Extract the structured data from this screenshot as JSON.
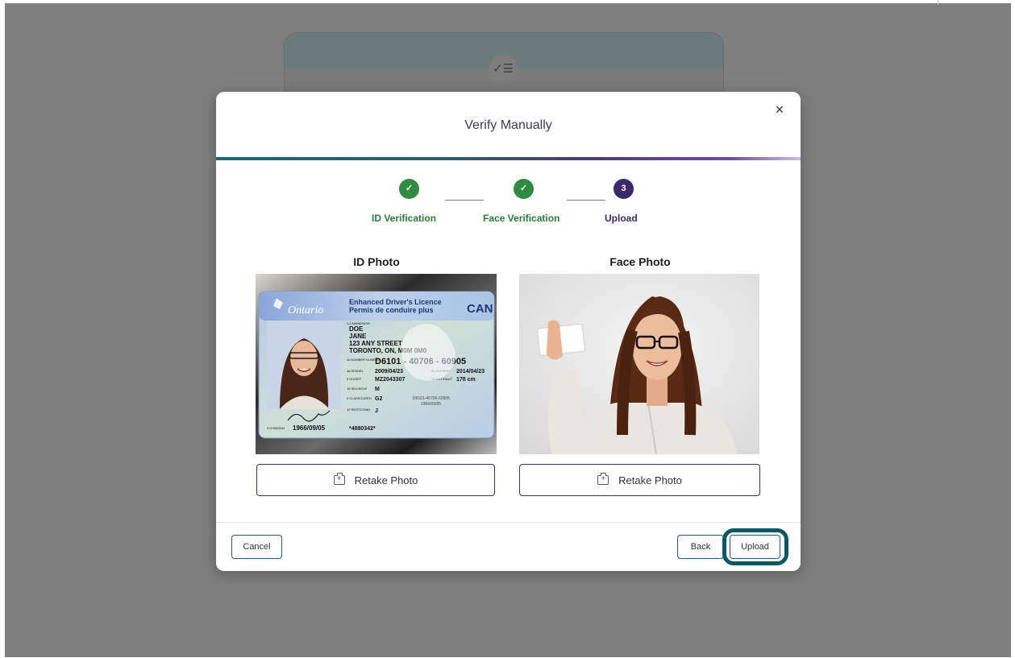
{
  "modal": {
    "title": "Verify Manually",
    "close_icon": "×",
    "check_icon": "✓"
  },
  "stepper": {
    "steps": [
      {
        "label": "ID Verification",
        "status": "done"
      },
      {
        "label": "Face Verification",
        "status": "done"
      },
      {
        "label": "Upload",
        "status": "current",
        "number": "3"
      }
    ],
    "colors": {
      "done": "#2e8b3f",
      "current": "#3b2a6b"
    }
  },
  "photos": {
    "id_heading": "ID Photo",
    "face_heading": "Face Photo",
    "retake_label": "Retake Photo"
  },
  "id_card": {
    "province": "Ontario",
    "title_en": "Enhanced Driver's Licence",
    "title_fr": "Permis de conduire plus",
    "country": "CAN",
    "name_label": "1,2 NAME/NOM",
    "last_name": "DOE",
    "first_name": "JANE",
    "address_line1": "123 ANY STREET",
    "address_line2": "TORONTO, ON, M0M 0M0",
    "number_label": "4d NUMBER NUMÉRO",
    "licence_number": "D6101 - 40706 - 60905",
    "iss_label": "4a ISS/DÉL",
    "issue_date": "2009/04/23",
    "exp_label": "4b EXP/EXP",
    "expiry_date": "2014/04/23",
    "ref_label": "5 DD/REF",
    "ref": "MZ2043307",
    "hgt_label": "16 HGT/HAUT",
    "height": "178 cm",
    "sex_label": "15 SEX/SEXE",
    "sex": "M",
    "class_label": "9 CLASS/CATÉG",
    "class": "G2",
    "rest_label": "12 REST/COND",
    "rest": "J",
    "dob_label": "3 DOB/DDN",
    "dob": "1966/09/05",
    "barcode_text": "*4880342*",
    "ghost_number": "D6101-40706-60905",
    "ghost_dob": "1966/09/05"
  },
  "footer": {
    "cancel_label": "Cancel",
    "back_label": "Back",
    "upload_label": "Upload"
  },
  "background_card": {
    "icon": "checklist-icon",
    "icon_glyph": "✓☰"
  }
}
